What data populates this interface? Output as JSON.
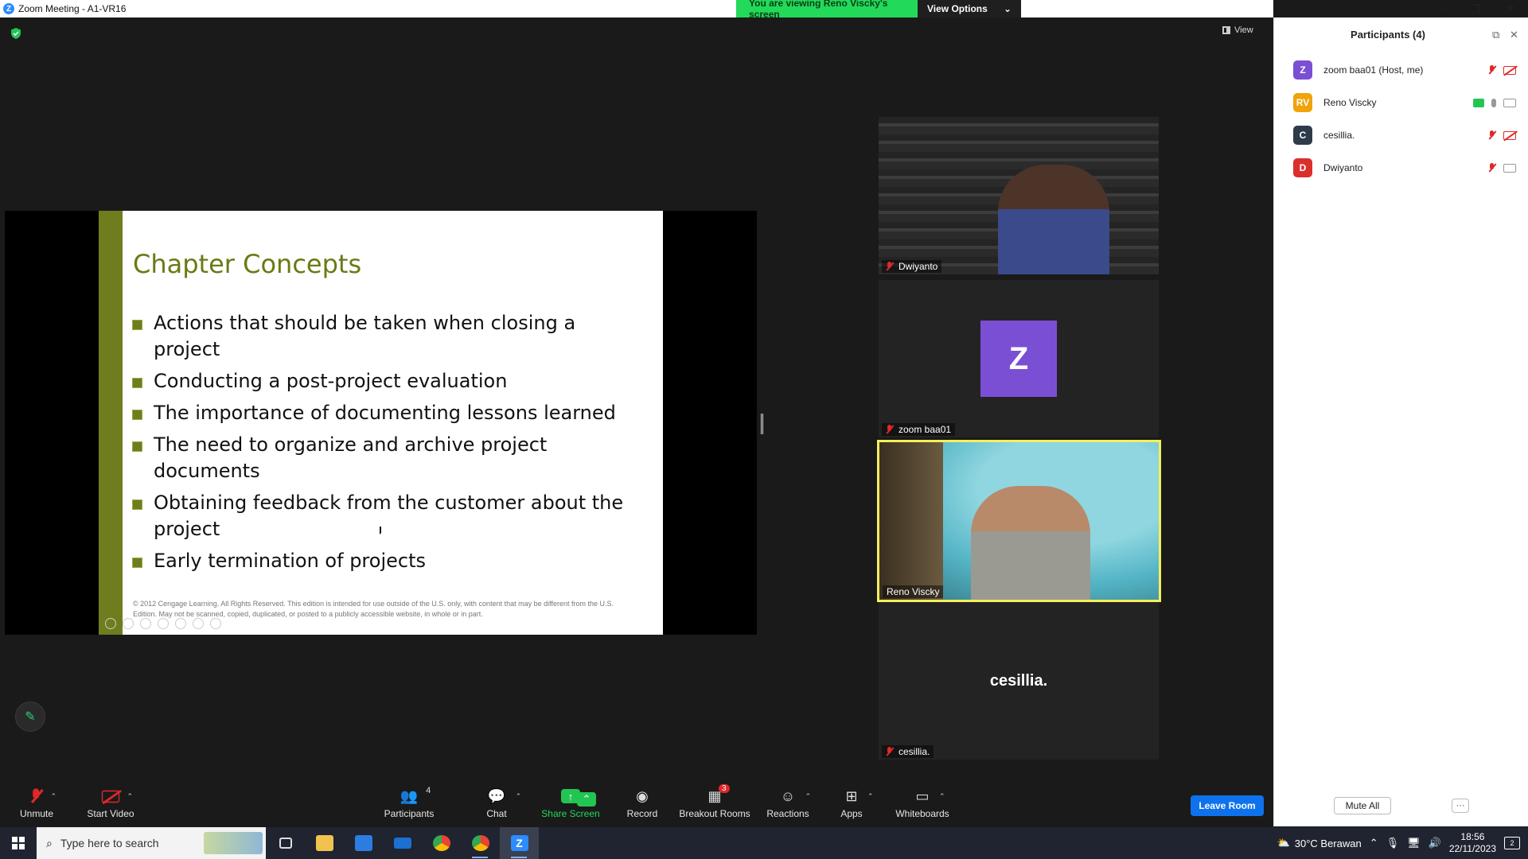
{
  "window": {
    "title": "Zoom Meeting - A1-VR16",
    "banner_text": "You are viewing Reno Viscky's screen",
    "view_options_label": "View Options",
    "minimize_glyph": "─",
    "restore_glyph": "❐",
    "close_glyph": "✕"
  },
  "stage": {
    "view_label": "View"
  },
  "slide": {
    "title": "Chapter Concepts",
    "bullets": [
      "Actions that should be taken when closing a project",
      "Conducting a post-project evaluation",
      "The importance of documenting lessons learned",
      "The need to organize and archive project documents",
      "Obtaining feedback from the customer about the project",
      "Early termination of projects"
    ],
    "footer": "© 2012 Cengage Learning. All Rights Reserved. This edition is intended for use outside of the U.S. only, with content that may be different from the U.S. Edition. May not be scanned, copied, duplicated, or posted to a publicly accessible website, in whole or in part."
  },
  "tiles": [
    {
      "name": "Dwiyanto",
      "muted": true
    },
    {
      "name": "zoom baa01",
      "muted": true,
      "avatar_letter": "Z"
    },
    {
      "name": "Reno Viscky",
      "muted": false
    },
    {
      "name": "cesillia.",
      "muted": true,
      "display_text": "cesillia."
    }
  ],
  "toolbar": {
    "unmute": "Unmute",
    "start_video": "Start Video",
    "participants": "Participants",
    "participants_count": "4",
    "chat": "Chat",
    "share_screen": "Share Screen",
    "record": "Record",
    "breakout_rooms": "Breakout Rooms",
    "breakout_badge": "3",
    "reactions": "Reactions",
    "apps": "Apps",
    "whiteboards": "Whiteboards",
    "leave_room": "Leave Room"
  },
  "panel": {
    "title": "Participants (4)",
    "participants": [
      {
        "initials": "Z",
        "name": "zoom baa01 (Host, me)",
        "color": "#7b4fd4",
        "mic": "off",
        "video": "off"
      },
      {
        "initials": "RV",
        "name": "Reno Viscky",
        "color": "#f0a30a",
        "mic": "on",
        "video": "on",
        "sharing": true
      },
      {
        "initials": "C",
        "name": "cesillia.",
        "color": "#2f3a4a",
        "mic": "off",
        "video": "off"
      },
      {
        "initials": "D",
        "name": "Dwiyanto",
        "color": "#d9302c",
        "mic": "off",
        "video": "on"
      }
    ],
    "mute_all": "Mute All",
    "more": "···"
  },
  "taskbar": {
    "search_placeholder": "Type here to search",
    "weather": "30°C  Berawan",
    "time": "18:56",
    "date": "22/11/2023",
    "notifications": "2"
  }
}
